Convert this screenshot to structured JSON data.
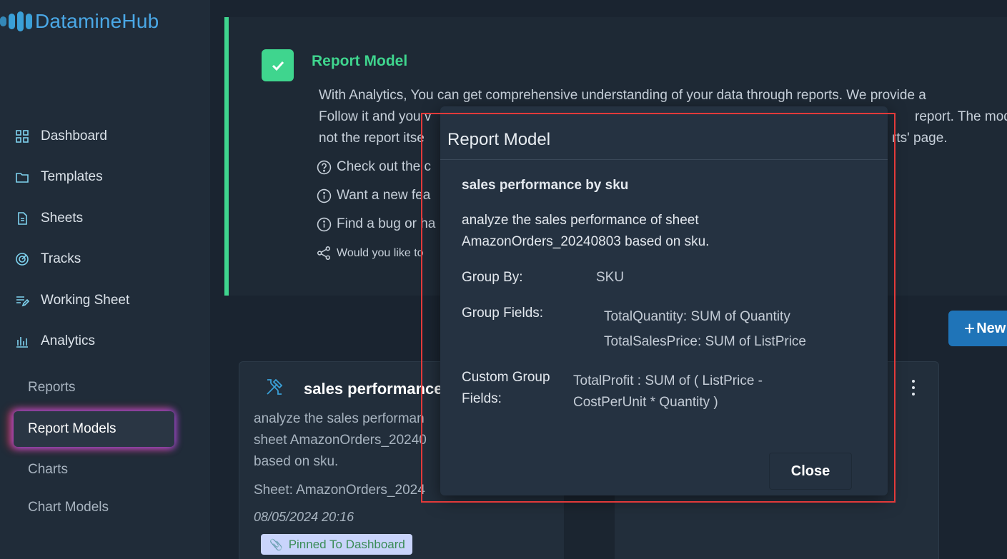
{
  "app": {
    "name": "DatamineHub"
  },
  "sidebar": {
    "items": [
      {
        "label": "Dashboard",
        "icon": "grid-icon"
      },
      {
        "label": "Templates",
        "icon": "folder-icon"
      },
      {
        "label": "Sheets",
        "icon": "file-icon"
      },
      {
        "label": "Tracks",
        "icon": "target-icon"
      },
      {
        "label": "Working Sheet",
        "icon": "edit-list-icon"
      },
      {
        "label": "Analytics",
        "icon": "bar-chart-icon"
      }
    ],
    "sub_items": [
      "Reports",
      "Report Models",
      "Charts",
      "Chart Models"
    ],
    "active": "Report Models"
  },
  "banner": {
    "title": "Report Model",
    "line1": "With Analytics, You can get comprehensive understanding of your data through reports. We provide a",
    "line2_start": "Follow it and you v",
    "line2_end": "report. The mode",
    "line3_start": "not the report itse",
    "line3_end": "rts' page.",
    "link1": "Check out the c",
    "link2": "Want a new fea",
    "link3": "Find a bug or ha",
    "link4": "Would you like to"
  },
  "new_button": {
    "label": "New"
  },
  "card": {
    "title": "sales performance",
    "desc_line1": "analyze the sales performan",
    "desc_line2": "sheet AmazonOrders_20240",
    "desc_line3": "based on sku.",
    "sheet": "Sheet: AmazonOrders_2024",
    "date": "08/05/2024 20:16",
    "pinned": "Pinned To Dashboard"
  },
  "modal": {
    "title": "Report Model",
    "name": "sales performance by sku",
    "description_line1": "analyze the sales performance of sheet",
    "description_line2": "AmazonOrders_20240803 based on sku.",
    "group_by_label": "Group By:",
    "group_by_value": "SKU",
    "group_fields_label": "Group Fields:",
    "group_fields": [
      "TotalQuantity: SUM of Quantity",
      "TotalSalesPrice: SUM of ListPrice"
    ],
    "custom_label_line1": "Custom Group",
    "custom_label_line2": "Fields:",
    "custom_value_line1": "TotalProfit : SUM of ( ListPrice -",
    "custom_value_line2": "CostPerUnit * Quantity )",
    "close_label": "Close"
  },
  "colors": {
    "accent_green": "#3fd58e",
    "accent_blue": "#1f74b8",
    "highlight_red": "#e23a3a"
  }
}
